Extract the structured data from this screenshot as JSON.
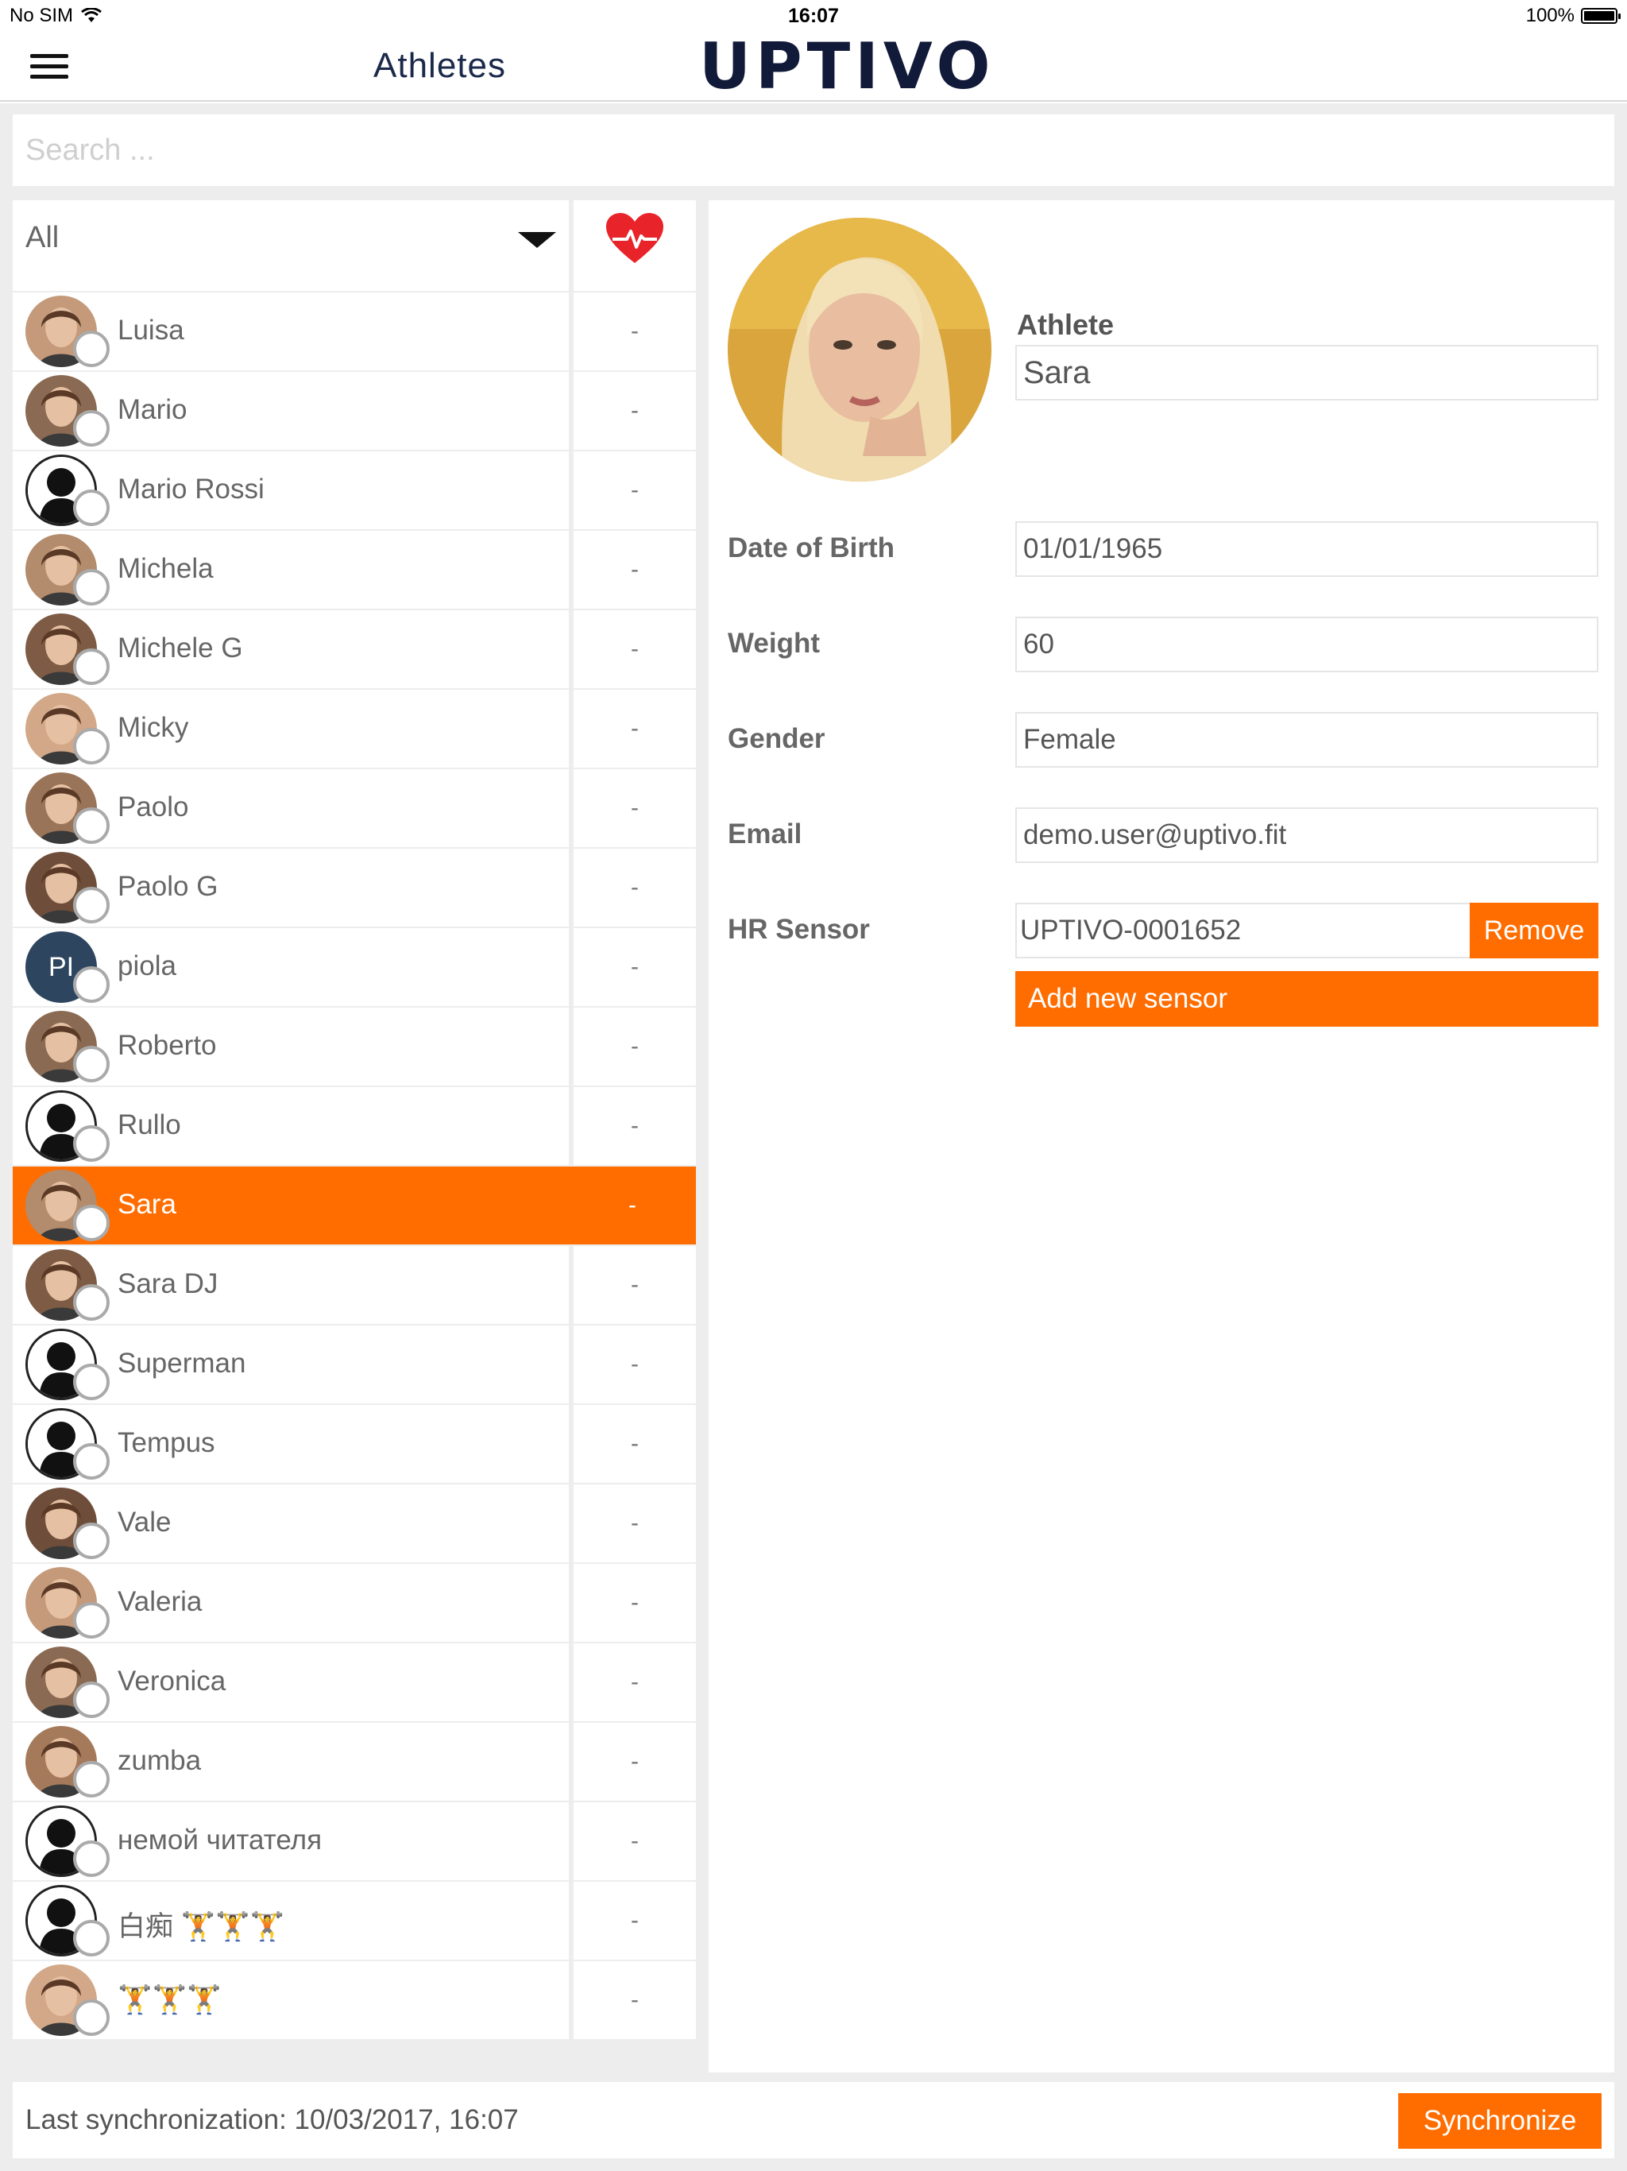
{
  "status_bar": {
    "carrier": "No SIM",
    "time": "16:07",
    "battery": "100%"
  },
  "nav": {
    "title": "Athletes",
    "logo": "UPTIVO"
  },
  "search": {
    "placeholder": "Search ..."
  },
  "filter": {
    "selected": "All"
  },
  "athletes": [
    {
      "name": "Luisa",
      "hr": "-",
      "avatar": "photo"
    },
    {
      "name": "Mario",
      "hr": "-",
      "avatar": "photo"
    },
    {
      "name": "Mario Rossi",
      "hr": "-",
      "avatar": "silhouette"
    },
    {
      "name": "Michela",
      "hr": "-",
      "avatar": "photo"
    },
    {
      "name": "Michele G",
      "hr": "-",
      "avatar": "photo"
    },
    {
      "name": "Micky",
      "hr": "-",
      "avatar": "photo"
    },
    {
      "name": "Paolo",
      "hr": "-",
      "avatar": "photo"
    },
    {
      "name": "Paolo G",
      "hr": "-",
      "avatar": "photo"
    },
    {
      "name": "piola",
      "hr": "-",
      "avatar": "initials",
      "initials": "PI"
    },
    {
      "name": "Roberto",
      "hr": "-",
      "avatar": "photo"
    },
    {
      "name": "Rullo",
      "hr": "-",
      "avatar": "silhouette"
    },
    {
      "name": "Sara",
      "hr": "-",
      "avatar": "photo",
      "selected": true
    },
    {
      "name": "Sara DJ",
      "hr": "-",
      "avatar": "photo"
    },
    {
      "name": "Superman",
      "hr": "-",
      "avatar": "silhouette"
    },
    {
      "name": "Tempus",
      "hr": "-",
      "avatar": "silhouette"
    },
    {
      "name": "Vale",
      "hr": "-",
      "avatar": "photo"
    },
    {
      "name": "Valeria",
      "hr": "-",
      "avatar": "photo"
    },
    {
      "name": "Veronica",
      "hr": "-",
      "avatar": "photo"
    },
    {
      "name": "zumba",
      "hr": "-",
      "avatar": "photo"
    },
    {
      "name": "немой читателя",
      "hr": "-",
      "avatar": "silhouette"
    },
    {
      "name": "白痴 🏋🏋🏋",
      "hr": "-",
      "avatar": "silhouette"
    },
    {
      "name": "🏋🏋🏋",
      "hr": "-",
      "avatar": "photo"
    }
  ],
  "detail": {
    "athlete_label": "Athlete",
    "name": "Sara",
    "dob_label": "Date of Birth",
    "dob": "01/01/1965",
    "weight_label": "Weight",
    "weight": "60",
    "gender_label": "Gender",
    "gender": "Female",
    "email_label": "Email",
    "email": "demo.user@uptivo.fit",
    "sensor_label": "HR Sensor",
    "sensor": "UPTIVO-0001652",
    "remove_label": "Remove",
    "add_sensor_label": "Add new sensor"
  },
  "footer": {
    "last_sync": "Last synchronization: 10/03/2017, 16:07",
    "sync_label": "Synchronize"
  },
  "colors": {
    "accent": "#ff6d00",
    "brand_navy": "#121a3a",
    "heart": "#e8232a"
  }
}
